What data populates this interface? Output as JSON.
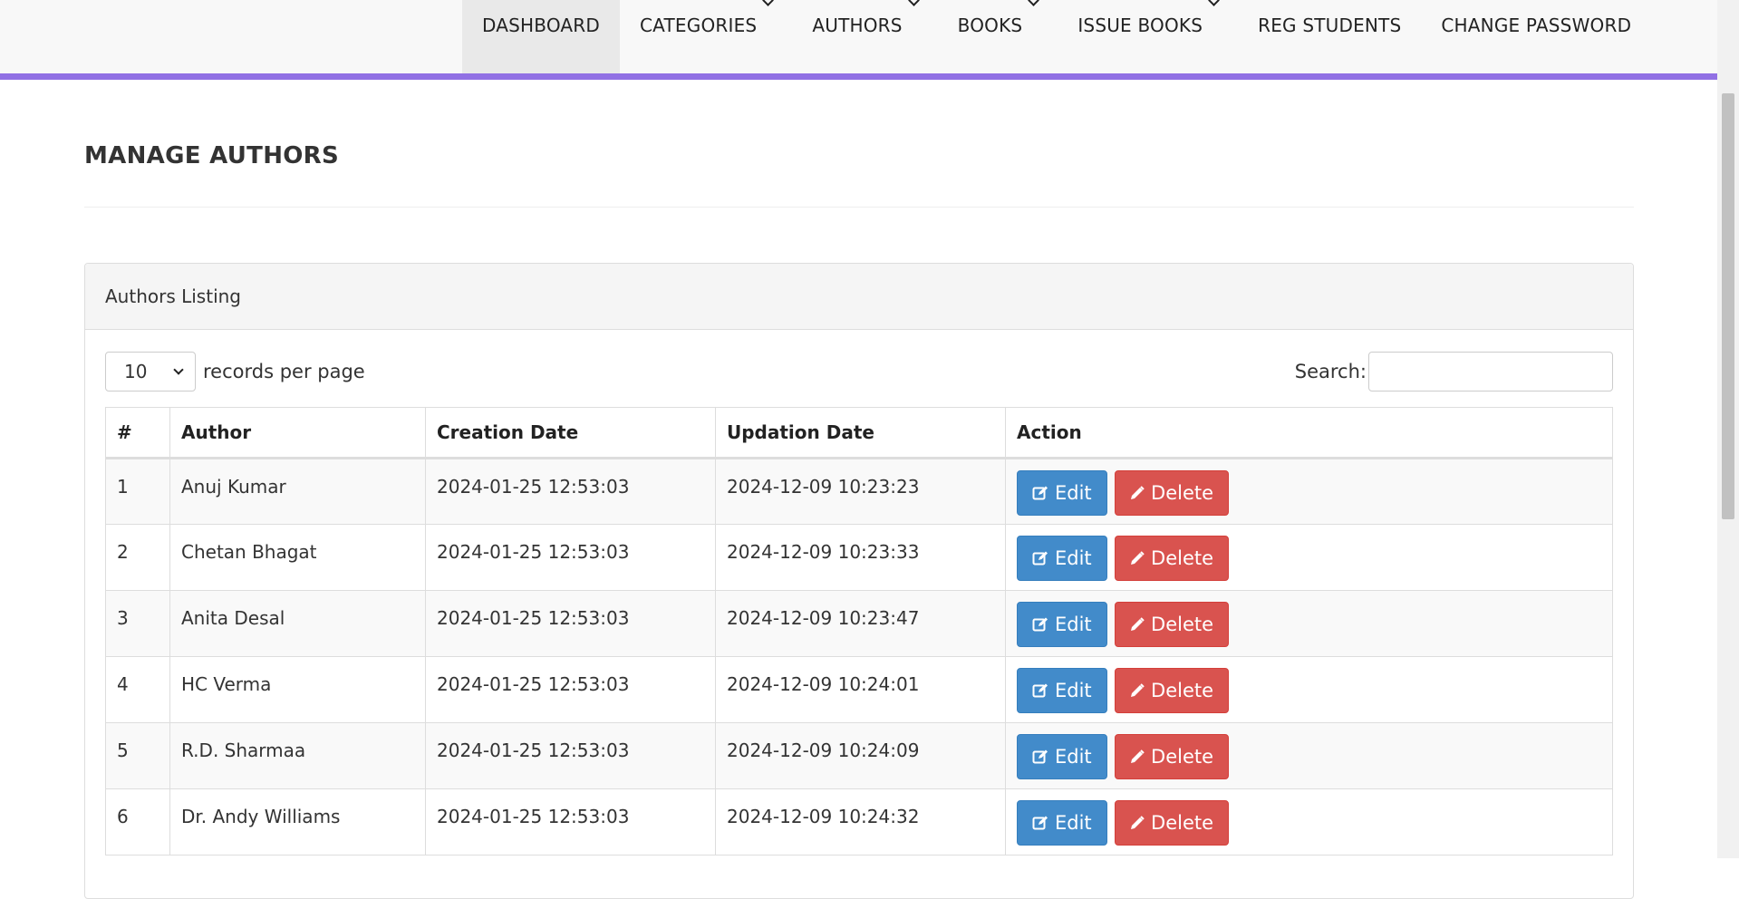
{
  "nav": {
    "items": [
      {
        "label": "DASHBOARD",
        "dropdown": false,
        "active": true
      },
      {
        "label": "CATEGORIES",
        "dropdown": true
      },
      {
        "label": "AUTHORS",
        "dropdown": true
      },
      {
        "label": "BOOKS",
        "dropdown": true
      },
      {
        "label": "ISSUE BOOKS",
        "dropdown": true
      },
      {
        "label": "REG STUDENTS",
        "dropdown": false
      },
      {
        "label": "CHANGE PASSWORD",
        "dropdown": false
      }
    ],
    "accent_color": "#9170e4"
  },
  "page": {
    "title": "MANAGE AUTHORS"
  },
  "panel": {
    "heading": "Authors Listing",
    "length": {
      "value": "10",
      "suffix": "records per page"
    },
    "search": {
      "label": "Search:",
      "value": ""
    }
  },
  "table": {
    "headers": [
      "#",
      "Author",
      "Creation Date",
      "Updation Date",
      "Action"
    ],
    "rows": [
      {
        "num": "1",
        "author": "Anuj Kumar",
        "created": "2024-01-25 12:53:03",
        "updated": "2024-12-09 10:23:23"
      },
      {
        "num": "2",
        "author": "Chetan Bhagat",
        "created": "2024-01-25 12:53:03",
        "updated": "2024-12-09 10:23:33"
      },
      {
        "num": "3",
        "author": "Anita Desal",
        "created": "2024-01-25 12:53:03",
        "updated": "2024-12-09 10:23:47"
      },
      {
        "num": "4",
        "author": "HC Verma",
        "created": "2024-01-25 12:53:03",
        "updated": "2024-12-09 10:24:01"
      },
      {
        "num": "5",
        "author": "R.D. Sharmaa",
        "created": "2024-01-25 12:53:03",
        "updated": "2024-12-09 10:24:09"
      },
      {
        "num": "6",
        "author": "Dr. Andy Williams",
        "created": "2024-01-25 12:53:03",
        "updated": "2024-12-09 10:24:32"
      }
    ],
    "edit_label": "Edit",
    "delete_label": "Delete",
    "edit_icon": "edit-icon",
    "delete_icon": "pencil-icon",
    "edit_color": "#428bca",
    "delete_color": "#d9534f"
  }
}
